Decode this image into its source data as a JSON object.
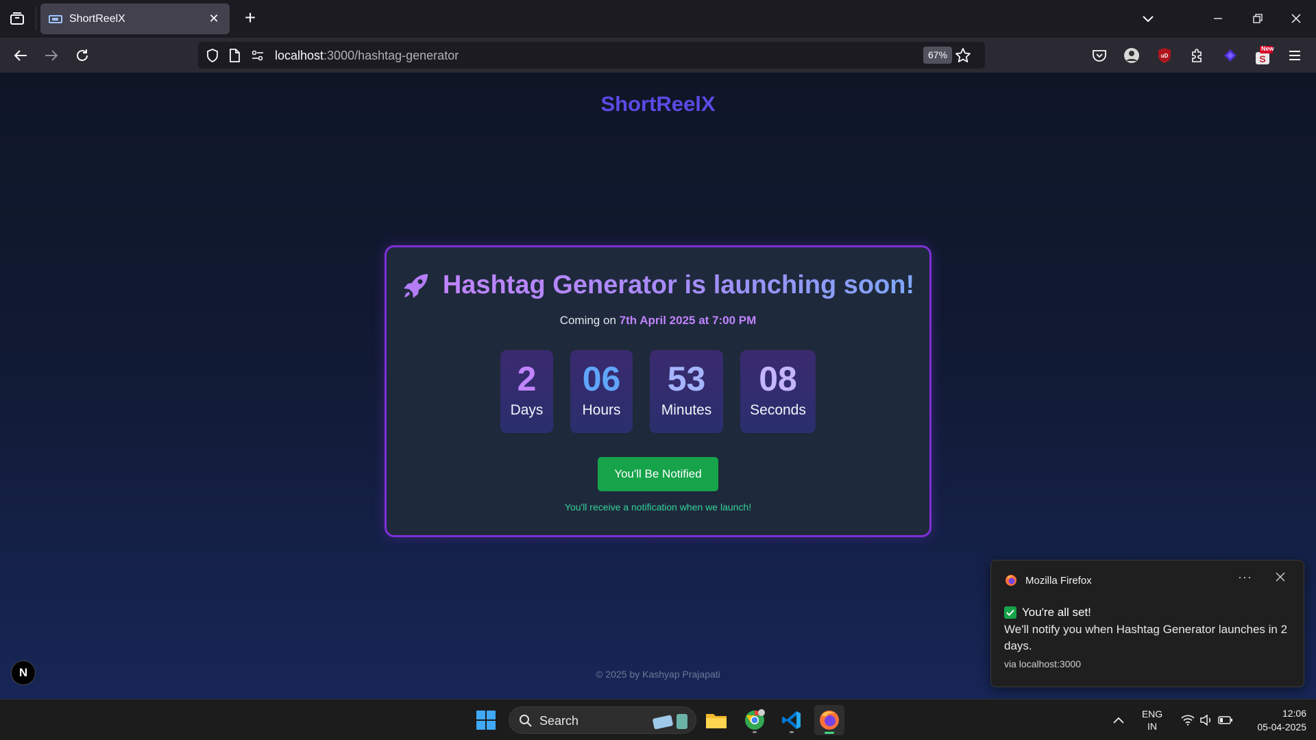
{
  "browser": {
    "tab_title": "ShortReelX",
    "url_host": "localhost",
    "url_path": ":3000/hashtag-generator",
    "zoom": "67%",
    "new_badge": "New"
  },
  "page": {
    "logo": "ShortReelX",
    "card": {
      "title": "Hashtag Generator is launching soon!",
      "subtitle_prefix": "Coming on",
      "subtitle_date": "7th April 2025 at 7:00 PM",
      "countdown": [
        {
          "value": "2",
          "label": "Days",
          "color": "#c084fc"
        },
        {
          "value": "06",
          "label": "Hours",
          "color": "#60a5fa"
        },
        {
          "value": "53",
          "label": "Minutes",
          "color": "#a5b4fc"
        },
        {
          "value": "08",
          "label": "Seconds",
          "color": "#c4b5fd"
        }
      ],
      "button_label": "You'll Be Notified",
      "note": "You'll receive a notification when we launch!"
    },
    "footer": "© 2025 by Kashyap Prajapati",
    "dev_badge": "N"
  },
  "toast": {
    "app": "Mozilla Firefox",
    "more": "···",
    "title": "You're all set!",
    "body": "We'll notify you when Hashtag Generator launches in 2 days.",
    "via": "via localhost:3000"
  },
  "taskbar": {
    "search_label": "Search",
    "lang_1": "ENG",
    "lang_2": "IN",
    "time": "12:06",
    "date": "05-04-2025"
  },
  "colors": {
    "accent_purple": "#7e2fd6",
    "logo": "#5b4ae6",
    "button_green": "#16a34a"
  }
}
